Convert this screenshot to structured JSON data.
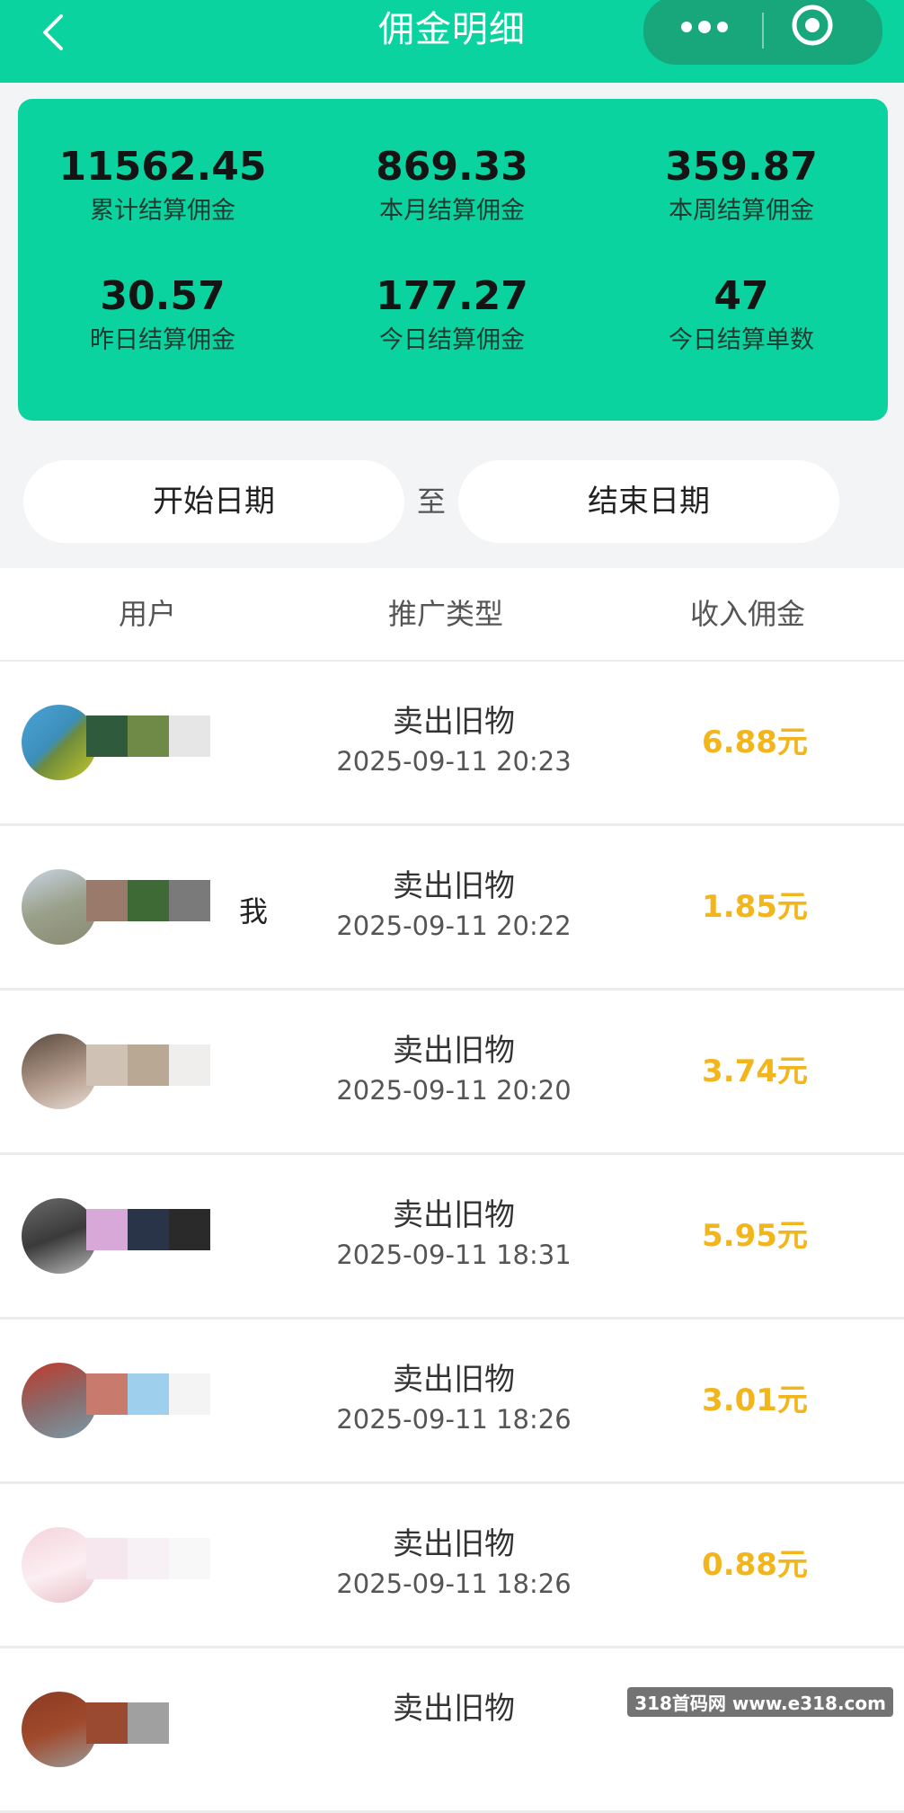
{
  "nav": {
    "title": "佣金明细"
  },
  "stats": [
    {
      "value": "11562.45",
      "label": "累计结算佣金"
    },
    {
      "value": "869.33",
      "label": "本月结算佣金"
    },
    {
      "value": "359.87",
      "label": "本周结算佣金"
    },
    {
      "value": "30.57",
      "label": "昨日结算佣金"
    },
    {
      "value": "177.27",
      "label": "今日结算佣金"
    },
    {
      "value": "47",
      "label": "今日结算单数"
    }
  ],
  "date_filter": {
    "start_label": "开始日期",
    "separator": "至",
    "end_label": "结束日期"
  },
  "table": {
    "headers": [
      "用户",
      "推广类型",
      "收入佣金"
    ],
    "rows": [
      {
        "user": "",
        "type": "卖出旧物",
        "time": "2025-09-11 20:23",
        "commission": "6.88元"
      },
      {
        "user": "我",
        "type": "卖出旧物",
        "time": "2025-09-11 20:22",
        "commission": "1.85元"
      },
      {
        "user": "",
        "type": "卖出旧物",
        "time": "2025-09-11 20:20",
        "commission": "3.74元"
      },
      {
        "user": "",
        "type": "卖出旧物",
        "time": "2025-09-11 18:31",
        "commission": "5.95元"
      },
      {
        "user": "",
        "type": "卖出旧物",
        "time": "2025-09-11 18:26",
        "commission": "3.01元"
      },
      {
        "user": "",
        "type": "卖出旧物",
        "time": "2025-09-11 18:26",
        "commission": "0.88元"
      },
      {
        "user": "",
        "type": "卖出旧物",
        "time": "",
        "commission": ""
      }
    ]
  },
  "watermark": "318首码网 www.e318.com",
  "colors": {
    "brand": "#0bd3a0",
    "commission": "#f2b51c"
  }
}
